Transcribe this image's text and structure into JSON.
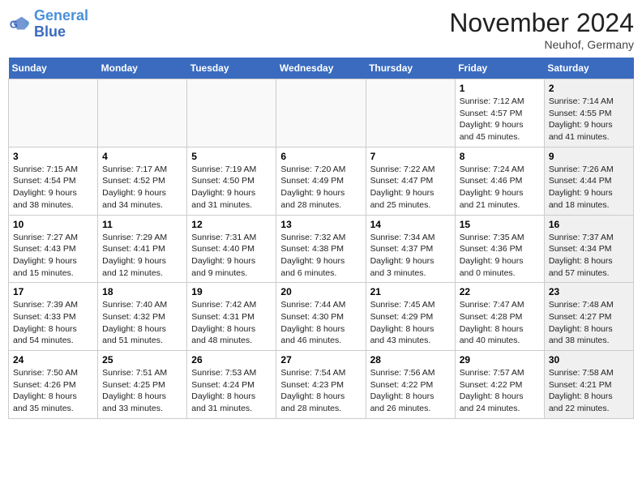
{
  "header": {
    "logo_line1": "General",
    "logo_line2": "Blue",
    "month": "November 2024",
    "location": "Neuhof, Germany"
  },
  "days_of_week": [
    "Sunday",
    "Monday",
    "Tuesday",
    "Wednesday",
    "Thursday",
    "Friday",
    "Saturday"
  ],
  "weeks": [
    [
      {
        "day": "",
        "info": "",
        "shaded": false
      },
      {
        "day": "",
        "info": "",
        "shaded": false
      },
      {
        "day": "",
        "info": "",
        "shaded": false
      },
      {
        "day": "",
        "info": "",
        "shaded": false
      },
      {
        "day": "",
        "info": "",
        "shaded": false
      },
      {
        "day": "1",
        "info": "Sunrise: 7:12 AM\nSunset: 4:57 PM\nDaylight: 9 hours\nand 45 minutes.",
        "shaded": false
      },
      {
        "day": "2",
        "info": "Sunrise: 7:14 AM\nSunset: 4:55 PM\nDaylight: 9 hours\nand 41 minutes.",
        "shaded": true
      }
    ],
    [
      {
        "day": "3",
        "info": "Sunrise: 7:15 AM\nSunset: 4:54 PM\nDaylight: 9 hours\nand 38 minutes.",
        "shaded": false
      },
      {
        "day": "4",
        "info": "Sunrise: 7:17 AM\nSunset: 4:52 PM\nDaylight: 9 hours\nand 34 minutes.",
        "shaded": false
      },
      {
        "day": "5",
        "info": "Sunrise: 7:19 AM\nSunset: 4:50 PM\nDaylight: 9 hours\nand 31 minutes.",
        "shaded": false
      },
      {
        "day": "6",
        "info": "Sunrise: 7:20 AM\nSunset: 4:49 PM\nDaylight: 9 hours\nand 28 minutes.",
        "shaded": false
      },
      {
        "day": "7",
        "info": "Sunrise: 7:22 AM\nSunset: 4:47 PM\nDaylight: 9 hours\nand 25 minutes.",
        "shaded": false
      },
      {
        "day": "8",
        "info": "Sunrise: 7:24 AM\nSunset: 4:46 PM\nDaylight: 9 hours\nand 21 minutes.",
        "shaded": false
      },
      {
        "day": "9",
        "info": "Sunrise: 7:26 AM\nSunset: 4:44 PM\nDaylight: 9 hours\nand 18 minutes.",
        "shaded": true
      }
    ],
    [
      {
        "day": "10",
        "info": "Sunrise: 7:27 AM\nSunset: 4:43 PM\nDaylight: 9 hours\nand 15 minutes.",
        "shaded": false
      },
      {
        "day": "11",
        "info": "Sunrise: 7:29 AM\nSunset: 4:41 PM\nDaylight: 9 hours\nand 12 minutes.",
        "shaded": false
      },
      {
        "day": "12",
        "info": "Sunrise: 7:31 AM\nSunset: 4:40 PM\nDaylight: 9 hours\nand 9 minutes.",
        "shaded": false
      },
      {
        "day": "13",
        "info": "Sunrise: 7:32 AM\nSunset: 4:38 PM\nDaylight: 9 hours\nand 6 minutes.",
        "shaded": false
      },
      {
        "day": "14",
        "info": "Sunrise: 7:34 AM\nSunset: 4:37 PM\nDaylight: 9 hours\nand 3 minutes.",
        "shaded": false
      },
      {
        "day": "15",
        "info": "Sunrise: 7:35 AM\nSunset: 4:36 PM\nDaylight: 9 hours\nand 0 minutes.",
        "shaded": false
      },
      {
        "day": "16",
        "info": "Sunrise: 7:37 AM\nSunset: 4:34 PM\nDaylight: 8 hours\nand 57 minutes.",
        "shaded": true
      }
    ],
    [
      {
        "day": "17",
        "info": "Sunrise: 7:39 AM\nSunset: 4:33 PM\nDaylight: 8 hours\nand 54 minutes.",
        "shaded": false
      },
      {
        "day": "18",
        "info": "Sunrise: 7:40 AM\nSunset: 4:32 PM\nDaylight: 8 hours\nand 51 minutes.",
        "shaded": false
      },
      {
        "day": "19",
        "info": "Sunrise: 7:42 AM\nSunset: 4:31 PM\nDaylight: 8 hours\nand 48 minutes.",
        "shaded": false
      },
      {
        "day": "20",
        "info": "Sunrise: 7:44 AM\nSunset: 4:30 PM\nDaylight: 8 hours\nand 46 minutes.",
        "shaded": false
      },
      {
        "day": "21",
        "info": "Sunrise: 7:45 AM\nSunset: 4:29 PM\nDaylight: 8 hours\nand 43 minutes.",
        "shaded": false
      },
      {
        "day": "22",
        "info": "Sunrise: 7:47 AM\nSunset: 4:28 PM\nDaylight: 8 hours\nand 40 minutes.",
        "shaded": false
      },
      {
        "day": "23",
        "info": "Sunrise: 7:48 AM\nSunset: 4:27 PM\nDaylight: 8 hours\nand 38 minutes.",
        "shaded": true
      }
    ],
    [
      {
        "day": "24",
        "info": "Sunrise: 7:50 AM\nSunset: 4:26 PM\nDaylight: 8 hours\nand 35 minutes.",
        "shaded": false
      },
      {
        "day": "25",
        "info": "Sunrise: 7:51 AM\nSunset: 4:25 PM\nDaylight: 8 hours\nand 33 minutes.",
        "shaded": false
      },
      {
        "day": "26",
        "info": "Sunrise: 7:53 AM\nSunset: 4:24 PM\nDaylight: 8 hours\nand 31 minutes.",
        "shaded": false
      },
      {
        "day": "27",
        "info": "Sunrise: 7:54 AM\nSunset: 4:23 PM\nDaylight: 8 hours\nand 28 minutes.",
        "shaded": false
      },
      {
        "day": "28",
        "info": "Sunrise: 7:56 AM\nSunset: 4:22 PM\nDaylight: 8 hours\nand 26 minutes.",
        "shaded": false
      },
      {
        "day": "29",
        "info": "Sunrise: 7:57 AM\nSunset: 4:22 PM\nDaylight: 8 hours\nand 24 minutes.",
        "shaded": false
      },
      {
        "day": "30",
        "info": "Sunrise: 7:58 AM\nSunset: 4:21 PM\nDaylight: 8 hours\nand 22 minutes.",
        "shaded": true
      }
    ]
  ]
}
